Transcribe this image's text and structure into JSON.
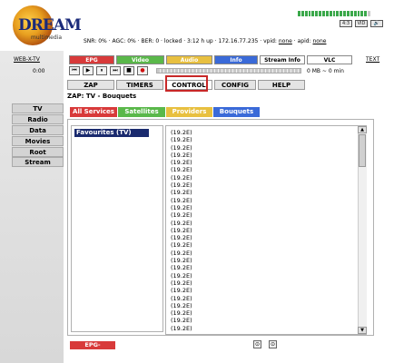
{
  "header": {
    "logo_word": "DREAM",
    "logo_sub": "multimedia",
    "status": {
      "snr": "SNR: 0%",
      "agc": "AGC: 0%",
      "ber": "BER: 0",
      "lock": "locked",
      "uptime": "3:12 h up",
      "ip": "172.16.77.235",
      "vpid_label": "vpid:",
      "vpid": "none",
      "apid_label": "apid:",
      "apid": "none"
    },
    "icons": [
      "4:3",
      "VID",
      "🔊"
    ]
  },
  "row1": {
    "web_x_tv": "WEB-X-TV",
    "tabs": [
      "EPG",
      "Video",
      "Audio",
      "Info",
      "Stream Info",
      "VLC"
    ],
    "text_link": "TEXT"
  },
  "row2": {
    "time": "0:00",
    "controls": [
      "⏮",
      "▶",
      "⏸",
      "⏭",
      "■",
      "●"
    ],
    "mb_text": "0 MB ~ 0 min"
  },
  "menu": [
    "ZAP",
    "TIMERS",
    "CONTROL",
    "CONFIG",
    "HELP"
  ],
  "breadcrumb": "ZAP: TV - Bouquets",
  "sidebar": [
    "TV",
    "Radio",
    "Data",
    "Movies",
    "Root",
    "Stream"
  ],
  "categories": [
    "All Services",
    "Satellites",
    "Providers",
    "Bouquets"
  ],
  "bouquet": "Favourites (TV)",
  "channels": [
    "(19.2E)",
    "(19.2E)",
    "(19.2E)",
    "(19.2E)",
    "(19.2E)",
    "(19.2E)",
    "(19.2E)",
    "(19.2E)",
    "(19.2E)",
    "(19.2E)",
    "(19.2E)",
    "(19.2E)",
    "(19.2E)",
    "(19.2E)",
    "(19.2E)",
    "(19.2E)",
    "(19.2E)",
    "(19.2E)",
    "(19.2E)",
    "(19.2E)",
    "(19.2E)",
    "(19.2E)",
    "(19.2E)",
    "(19.2E)",
    "(19.2E)",
    "(19.2E)",
    "(19.2E)"
  ],
  "footer": {
    "epg_overview": "EPG-Overview",
    "icons": [
      "⊙",
      "⊙"
    ]
  }
}
